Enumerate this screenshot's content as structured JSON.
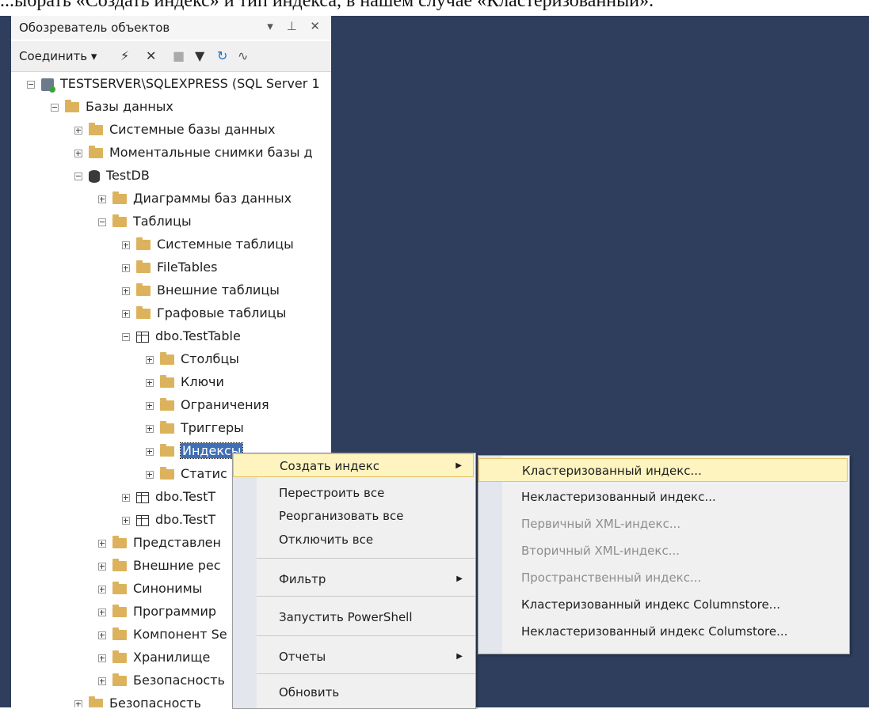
{
  "caption": "...ыбрать «Создать индекс» и тип индекса, в нашем случае «Кластеризованный».",
  "explorer": {
    "title": "Обозреватель объектов",
    "title_buttons": "▾ ⊥ ✕",
    "toolbar": {
      "connect_label": "Соединить ▾",
      "icons": [
        "connect-icon",
        "disconnect-icon",
        "stop-icon",
        "filter-icon",
        "refresh-icon",
        "activity-icon"
      ]
    },
    "tree": [
      {
        "label": "TESTSERVER\\SQLEXPRESS (SQL Server 1",
        "icon": "server-icon",
        "expanded": true
      },
      {
        "label": "Базы данных",
        "icon": "folder-icon",
        "expanded": true
      },
      {
        "label": "Системные базы данных",
        "icon": "folder-icon",
        "expanded": false
      },
      {
        "label": "Моментальные снимки базы д",
        "icon": "folder-icon",
        "expanded": false
      },
      {
        "label": "TestDB",
        "icon": "database-icon",
        "expanded": true
      },
      {
        "label": "Диаграммы баз данных",
        "icon": "folder-icon",
        "expanded": false
      },
      {
        "label": "Таблицы",
        "icon": "folder-icon",
        "expanded": true
      },
      {
        "label": "Системные таблицы",
        "icon": "folder-icon",
        "expanded": false
      },
      {
        "label": "FileTables",
        "icon": "folder-icon",
        "expanded": false
      },
      {
        "label": "Внешние таблицы",
        "icon": "folder-icon",
        "expanded": false
      },
      {
        "label": "Графовые таблицы",
        "icon": "folder-icon",
        "expanded": false
      },
      {
        "label": "dbo.TestTable",
        "icon": "table-icon",
        "expanded": true
      },
      {
        "label": "Столбцы",
        "icon": "folder-icon",
        "expanded": false
      },
      {
        "label": "Ключи",
        "icon": "folder-icon",
        "expanded": false
      },
      {
        "label": "Ограничения",
        "icon": "folder-icon",
        "expanded": false
      },
      {
        "label": "Триггеры",
        "icon": "folder-icon",
        "expanded": false
      },
      {
        "label": "Индексы",
        "icon": "folder-icon",
        "expanded": false,
        "selected": true
      },
      {
        "label": "Статис",
        "icon": "folder-icon",
        "expanded": false
      },
      {
        "label": "dbo.TestT",
        "icon": "table-icon",
        "expanded": false
      },
      {
        "label": "dbo.TestT",
        "icon": "table-icon",
        "expanded": false
      },
      {
        "label": "Представлен",
        "icon": "folder-icon",
        "expanded": false
      },
      {
        "label": "Внешние рес",
        "icon": "folder-icon",
        "expanded": false
      },
      {
        "label": "Синонимы",
        "icon": "folder-icon",
        "expanded": false
      },
      {
        "label": "Программир",
        "icon": "folder-icon",
        "expanded": false
      },
      {
        "label": "Компонент Se",
        "icon": "folder-icon",
        "expanded": false
      },
      {
        "label": "Хранилище",
        "icon": "folder-icon",
        "expanded": false
      },
      {
        "label": "Безопасность",
        "icon": "folder-icon",
        "expanded": false
      },
      {
        "label": "Безопасность",
        "icon": "folder-icon",
        "expanded": false
      }
    ]
  },
  "context_menu": {
    "items": [
      {
        "label": "Создать индекс",
        "submenu": true,
        "highlighted": true
      },
      {
        "label": "Перестроить все",
        "submenu": false
      },
      {
        "label": "Реорганизовать все",
        "submenu": false
      },
      {
        "label": "Отключить все",
        "submenu": false
      },
      {
        "label": "Фильтр",
        "submenu": true
      },
      {
        "label": "Запустить PowerShell",
        "submenu": false
      },
      {
        "label": "Отчеты",
        "submenu": true
      },
      {
        "label": "Обновить",
        "submenu": false
      }
    ],
    "submenu_arrow": "▶"
  },
  "submenu": {
    "items": [
      {
        "label": "Кластеризованный индекс...",
        "enabled": true,
        "highlighted": true
      },
      {
        "label": "Некластеризованный индекс...",
        "enabled": true
      },
      {
        "label": "Первичный XML-индекс...",
        "enabled": false
      },
      {
        "label": "Вторичный XML-индекс...",
        "enabled": false
      },
      {
        "label": "Пространственный индекс...",
        "enabled": false
      },
      {
        "label": "Кластеризованный индекс Columnstore...",
        "enabled": true
      },
      {
        "label": "Некластеризованный индекс Columstore...",
        "enabled": true
      }
    ]
  },
  "colors": {
    "background": "#2e3e5c",
    "highlight": "#fdf4bf",
    "selection": "#3f6fb5",
    "folder": "#dcb35c"
  }
}
